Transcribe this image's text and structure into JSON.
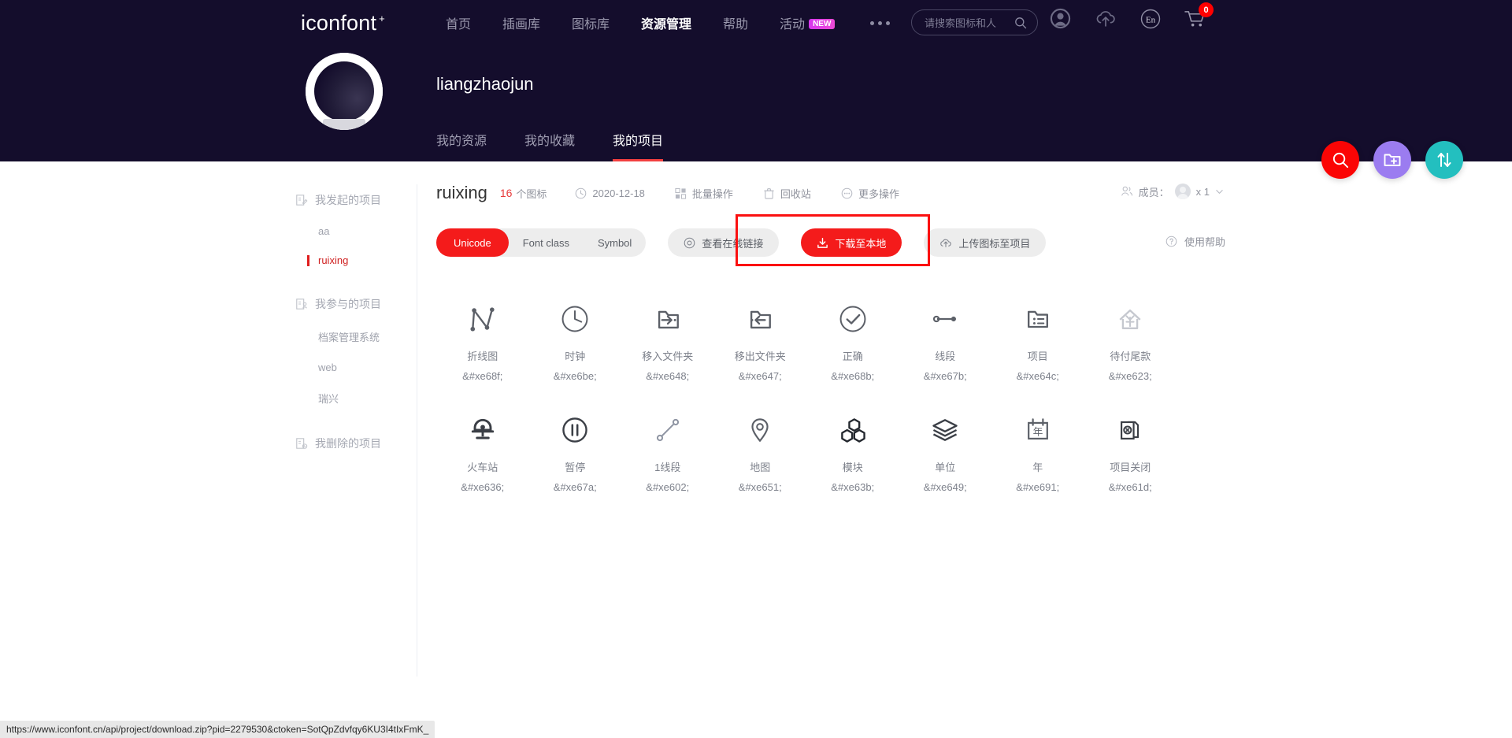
{
  "header": {
    "logo": "iconfont",
    "logo_plus": "+",
    "nav": [
      {
        "label": "首页",
        "active": false
      },
      {
        "label": "插画库",
        "active": false
      },
      {
        "label": "图标库",
        "active": false
      },
      {
        "label": "资源管理",
        "active": true
      },
      {
        "label": "帮助",
        "active": false
      },
      {
        "label": "活动",
        "active": false,
        "badge": "NEW"
      }
    ],
    "more_icon": "ellipsis-icon",
    "search": {
      "placeholder": "请搜索图标和人",
      "value": "",
      "icon": "search-icon"
    },
    "icons": [
      {
        "name": "user-avatar-icon"
      },
      {
        "name": "upload-cloud-icon"
      },
      {
        "name": "language-en-icon",
        "label": "En"
      },
      {
        "name": "shopping-cart-icon",
        "badge": "0"
      }
    ]
  },
  "profile": {
    "username": "liangzhaojun",
    "avatar": "user-avatar",
    "tabs": [
      {
        "label": "我的资源",
        "active": false
      },
      {
        "label": "我的收藏",
        "active": false
      },
      {
        "label": "我的项目",
        "active": true
      }
    ]
  },
  "fabs": [
    {
      "name": "search-fab",
      "icon": "search-icon",
      "color": "#fb0505"
    },
    {
      "name": "new-project-fab",
      "icon": "folder-plus-icon",
      "color": "#9b7cf0"
    },
    {
      "name": "sort-fab",
      "icon": "sort-arrows-icon",
      "color": "#23bfbf"
    }
  ],
  "sidebar": {
    "groups": [
      {
        "label": "我发起的项目",
        "icon": "project-create-icon",
        "items": [
          {
            "label": "aa",
            "active": false
          },
          {
            "label": "ruixing",
            "active": true
          }
        ]
      },
      {
        "label": "我参与的项目",
        "icon": "project-join-icon",
        "items": [
          {
            "label": "档案管理系统",
            "active": false
          },
          {
            "label": "web",
            "active": false
          },
          {
            "label": "瑞兴",
            "active": false
          }
        ]
      },
      {
        "label": "我删除的项目",
        "icon": "project-delete-icon",
        "items": []
      }
    ]
  },
  "project": {
    "name": "ruixing",
    "icon_count": "16",
    "icon_count_label": "个图标",
    "date": "2020-12-18",
    "date_icon": "clock-icon",
    "actions": [
      {
        "label": "批量操作",
        "icon": "batch-icon"
      },
      {
        "label": "回收站",
        "icon": "trash-icon"
      },
      {
        "label": "更多操作",
        "icon": "more-circle-icon"
      }
    ],
    "members_label": "成员：",
    "members_icon": "members-icon",
    "members_count": "x 1",
    "members_chevron": "chevron-down-icon"
  },
  "toolbar": {
    "segments": [
      {
        "label": "Unicode",
        "active": true
      },
      {
        "label": "Font class",
        "active": false
      },
      {
        "label": "Symbol",
        "active": false
      }
    ],
    "view_link": {
      "label": "查看在线链接",
      "icon": "eye-icon"
    },
    "download": {
      "label": "下载至本地",
      "icon": "download-icon"
    },
    "upload": {
      "label": "上传图标至项目",
      "icon": "upload-cloud-icon"
    },
    "help": {
      "label": "使用帮助",
      "icon": "question-circle-icon"
    }
  },
  "icons": [
    {
      "name": "折线图",
      "code": "&#xe68f;",
      "glyph": "polyline-chart-icon"
    },
    {
      "name": "时钟",
      "code": "&#xe6be;",
      "glyph": "clock-icon"
    },
    {
      "name": "移入文件夹",
      "code": "&#xe648;",
      "glyph": "move-into-folder-icon"
    },
    {
      "name": "移出文件夹",
      "code": "&#xe647;",
      "glyph": "move-out-folder-icon"
    },
    {
      "name": "正确",
      "code": "&#xe68b;",
      "glyph": "check-circle-icon"
    },
    {
      "name": "线段",
      "code": "&#xe67b;",
      "glyph": "line-segment-icon"
    },
    {
      "name": "项目",
      "code": "&#xe64c;",
      "glyph": "project-list-icon"
    },
    {
      "name": "待付尾款",
      "code": "&#xe623;",
      "glyph": "house-payment-icon"
    },
    {
      "name": "火车站",
      "code": "&#xe636;",
      "glyph": "train-station-icon"
    },
    {
      "name": "暂停",
      "code": "&#xe67a;",
      "glyph": "pause-circle-icon"
    },
    {
      "name": "1线段",
      "code": "&#xe602;",
      "glyph": "line-segment-alt-icon"
    },
    {
      "name": "地图",
      "code": "&#xe651;",
      "glyph": "map-pin-icon"
    },
    {
      "name": "模块",
      "code": "&#xe63b;",
      "glyph": "module-hexagons-icon"
    },
    {
      "name": "单位",
      "code": "&#xe649;",
      "glyph": "layers-icon"
    },
    {
      "name": "年",
      "code": "&#xe691;",
      "glyph": "year-calendar-icon"
    },
    {
      "name": "项目关闭",
      "code": "&#xe61d;",
      "glyph": "project-close-icon"
    }
  ],
  "statusbar": {
    "url": "https://www.iconfont.cn/api/project/download.zip?pid=2279530&ctoken=SotQpZdvfqy6KU3I4tIxFmK_"
  }
}
